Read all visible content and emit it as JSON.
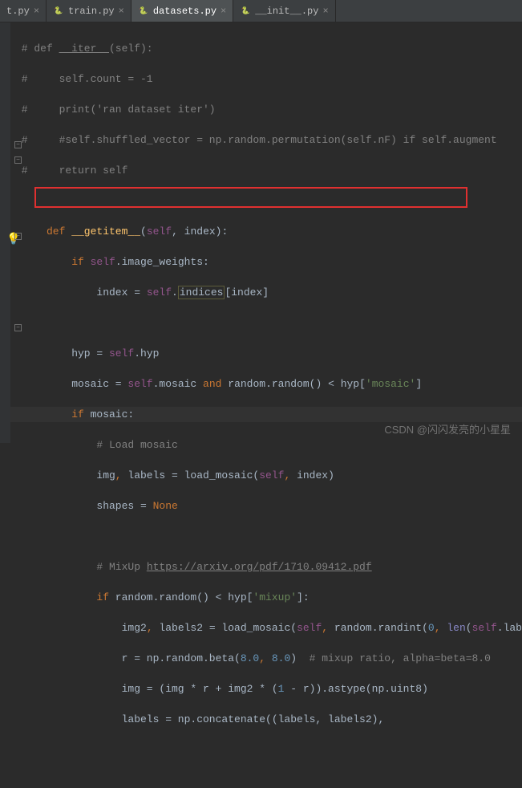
{
  "tabs": [
    {
      "label": "t.py",
      "active": false
    },
    {
      "label": "train.py",
      "active": false
    },
    {
      "label": "datasets.py",
      "active": true
    },
    {
      "label": "__init__.py",
      "active": false
    }
  ],
  "code": {
    "l1a": "# def ",
    "l1b": "__iter__",
    "l1c": "(self):",
    "l2": "#     self.count = -1",
    "l3": "#     print('ran dataset iter')",
    "l4": "#     #self.shuffled_vector = np.random.permutation(self.nF) if self.augment",
    "l5": "#     return self",
    "l6_def": "def ",
    "l6_fn": "__getitem__",
    "l6_sig_open": "(",
    "l6_self": "self",
    "l6_comma": ", ",
    "l6_index": "index):",
    "l7_if": "if ",
    "l7_self": "self",
    "l7_attr": ".image_weights:",
    "l8_pre": "index = ",
    "l8_self": "self",
    "l8_dot": ".",
    "l8_indices": "indices",
    "l8_post": "[index]",
    "l9_pre": "hyp = ",
    "l9_self": "self",
    "l9_attr": ".hyp",
    "l10_pre": "mosaic = ",
    "l10_self": "self",
    "l10_attr": ".mosaic ",
    "l10_and": "and ",
    "l10_rand": "random.random() < hyp[",
    "l10_str": "'mosaic'",
    "l10_end": "]",
    "l11_if": "if ",
    "l11_var": "mosaic:",
    "l12": "# Load mosaic",
    "l13_pre": "img",
    "l13_comma": ", ",
    "l13_labels": "labels = load_mosaic(",
    "l13_self": "self",
    "l13_comma2": ", ",
    "l13_end": "index)",
    "l14_pre": "shapes = ",
    "l14_none": "None",
    "l15a": "# MixUp ",
    "l15b": "https://arxiv.org/pdf/1710.09412.pdf",
    "l16_if": "if ",
    "l16_rand": "random.random() < hyp[",
    "l16_str": "'mixup'",
    "l16_end": "]:",
    "l17_pre": "img2",
    "l17_comma": ", ",
    "l17_mid": "labels2 = load_mosaic(",
    "l17_self": "self",
    "l17_comma2": ", ",
    "l17_rand": "random.randint(",
    "l17_zero": "0",
    "l17_comma3": ", ",
    "l17_len": "len",
    "l17_open": "(",
    "l17_self2": "self",
    "l17_end": ".lab",
    "l18_pre": "r = np.random.beta(",
    "l18_n1": "8.0",
    "l18_c": ", ",
    "l18_n2": "8.0",
    "l18_close": ")  ",
    "l18_comment": "# mixup ratio, alpha=beta=8.0",
    "l19_pre": "img = (img * r + img2 * (",
    "l19_one": "1",
    "l19_post": " - r)).astype(np.uint8)",
    "l20": "labels = np.concatenate((labels, labels2), "
  },
  "watermark": "CSDN @闪闪发亮的小星星"
}
